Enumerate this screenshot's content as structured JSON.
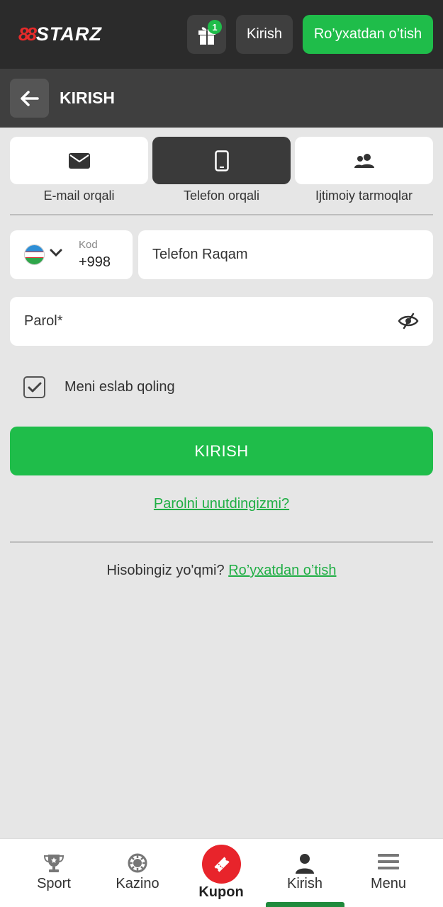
{
  "header": {
    "logo_mark": "88",
    "logo_text": "STARZ",
    "gift_badge": "1",
    "login_label": "Kirish",
    "register_label": "Ro’yxatdan o’tish"
  },
  "subheader": {
    "title": "KIRISH"
  },
  "tabs": [
    {
      "label": "E-mail orqali",
      "icon": "mail-icon",
      "active": false
    },
    {
      "label": "Telefon orqali",
      "icon": "phone-icon",
      "active": true
    },
    {
      "label": "Ijtimoiy tarmoqlar",
      "icon": "people-icon",
      "active": false
    }
  ],
  "form": {
    "code_label": "Kod",
    "code_value": "+998",
    "phone_placeholder": "Telefon Raqam",
    "password_placeholder": "Parol*",
    "remember_label": "Meni eslab qoling",
    "remember_checked": true,
    "submit_label": "KIRISH",
    "forgot_link": "Parolni unutdingizmi?",
    "no_account_text": "Hisobingiz yo'qmi?",
    "register_link": "Ro’yxatdan o’tish"
  },
  "bottom_nav": [
    {
      "label": "Sport",
      "icon": "trophy-icon"
    },
    {
      "label": "Kazino",
      "icon": "casino-chip-icon"
    },
    {
      "label": "Kupon",
      "icon": "ticket-icon"
    },
    {
      "label": "Kirish",
      "icon": "user-icon",
      "active": true
    },
    {
      "label": "Menu",
      "icon": "hamburger-icon"
    }
  ],
  "colors": {
    "brand_green": "#1fbd4a",
    "brand_red": "#e8242b",
    "header_bg": "#2b2b2b"
  }
}
